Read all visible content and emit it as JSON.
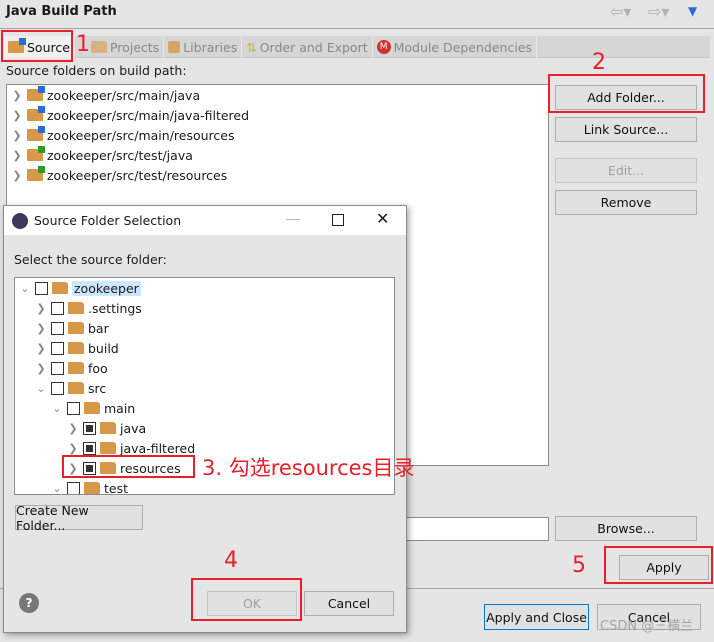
{
  "window": {
    "title": "Java Build Path"
  },
  "nav": {
    "back_icon": "arrow-left-icon",
    "forward_icon": "arrow-right-icon",
    "menu_icon": "triangle-down-icon"
  },
  "tabs": [
    {
      "label": "Source",
      "active": true
    },
    {
      "label": "Projects"
    },
    {
      "label": "Libraries"
    },
    {
      "label": "Order and Export"
    },
    {
      "label": "Module Dependencies"
    }
  ],
  "source_label": "Source folders on build path:",
  "source_folders": [
    "zookeeper/src/main/java",
    "zookeeper/src/main/java-filtered",
    "zookeeper/src/main/resources",
    "zookeeper/src/test/java",
    "zookeeper/src/test/resources"
  ],
  "buttons": {
    "add_folder": "Add Folder...",
    "link_source": "Link Source...",
    "edit": "Edit...",
    "remove": "Remove",
    "browse": "Browse...",
    "apply": "Apply",
    "apply_close": "Apply and Close",
    "cancel": "Cancel"
  },
  "dialog": {
    "title": "Source Folder Selection",
    "label": "Select the source folder:",
    "tree": [
      {
        "label": "zookeeper",
        "depth": 0,
        "expanded": true,
        "checked": false
      },
      {
        "label": ".settings",
        "depth": 1,
        "expanded": false,
        "checked": false
      },
      {
        "label": "bar",
        "depth": 1,
        "expanded": false,
        "checked": false
      },
      {
        "label": "build",
        "depth": 1,
        "expanded": false,
        "checked": false
      },
      {
        "label": "foo",
        "depth": 1,
        "expanded": false,
        "checked": false
      },
      {
        "label": "src",
        "depth": 1,
        "expanded": true,
        "checked": false
      },
      {
        "label": "main",
        "depth": 2,
        "expanded": true,
        "checked": false
      },
      {
        "label": "java",
        "depth": 3,
        "expanded": false,
        "checked": "partial"
      },
      {
        "label": "java-filtered",
        "depth": 3,
        "expanded": false,
        "checked": "partial"
      },
      {
        "label": "resources",
        "depth": 3,
        "expanded": false,
        "checked": "partial"
      },
      {
        "label": "test",
        "depth": 2,
        "expanded": true,
        "checked": false
      }
    ],
    "create_folder": "Create New Folder...",
    "ok": "OK",
    "cancel": "Cancel"
  },
  "annotations": {
    "a1": "1",
    "a2": "2",
    "a3": "3. 勾选resources目录",
    "a4": "4",
    "a5": "5",
    "color": "#e8202a"
  },
  "watermark": "CSDN @三横兰"
}
